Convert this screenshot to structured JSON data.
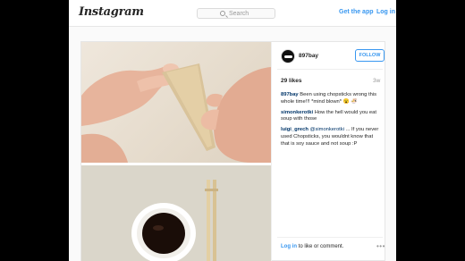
{
  "header": {
    "logo_text": "Instagram",
    "search_placeholder": "Search",
    "get_app_label": "Get the app",
    "login_label": "Log in"
  },
  "post": {
    "username": "897bay",
    "follow_label": "FOLLOW",
    "likes": "29 likes",
    "age": "3w",
    "comments": [
      {
        "user": "897bay",
        "text": " Been using chopsticks wrong this whole time!!! *mind blown* 😮 🍜"
      },
      {
        "user": "simonkerotki",
        "text": " How the hell would you eat soup with those"
      },
      {
        "user": "luigi_grech",
        "mention": "@simonkerotki",
        "text": " ... If you never used Chopsticks, you wouldnt know that that is soy sauce and not soup :P"
      }
    ],
    "footer": {
      "login_link": "Log in",
      "rest_text": " to like or comment.",
      "more_icon_glyph": "•••"
    }
  },
  "icons": [
    "search-icon",
    "avatar",
    "more-icon"
  ],
  "colors": {
    "accent": "#3897f0",
    "username": "#003569",
    "text": "#262626",
    "muted": "#999999",
    "letterbox": "#000000"
  }
}
